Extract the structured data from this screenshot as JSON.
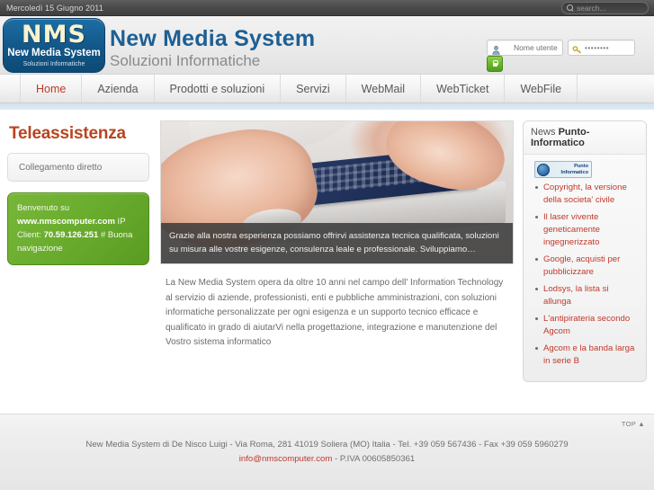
{
  "topbar": {
    "date": "Mercoledì 15 Giugno 2011",
    "search_placeholder": "search...",
    "search_value": "",
    "search_icon": "magnifier-icon"
  },
  "header": {
    "logo": {
      "mark": "NMS",
      "line2": "New Media System",
      "line3": "Soluzioni Informatiche"
    },
    "brand_title": "New Media System",
    "brand_subtitle": "Soluzioni Informatiche",
    "login": {
      "username_value": "Nome utente",
      "username_icon": "user-icon",
      "password_value": "••••••••",
      "password_icon": "key-icon",
      "submit_icon": "lock-icon"
    }
  },
  "nav": {
    "items": [
      {
        "label": "Home",
        "active": true
      },
      {
        "label": "Azienda",
        "active": false
      },
      {
        "label": "Prodotti e soluzioni",
        "active": false
      },
      {
        "label": "Servizi",
        "active": false
      },
      {
        "label": "WebMail",
        "active": false
      },
      {
        "label": "WebTicket",
        "active": false
      },
      {
        "label": "WebFile",
        "active": false
      }
    ]
  },
  "left": {
    "heading": "Teleassistenza",
    "direct_link_label": "Collegamento diretto",
    "welcome": {
      "line1": "Benvenuto su",
      "site": "www.nmscomputer.com",
      "ip_label": " IP Client: ",
      "ip": "70.59.126.251",
      "tail": " # Buona navigazione"
    }
  },
  "main": {
    "hero_caption": "Grazie alla nostra esperienza possiamo offrirvi assistenza tecnica qualificata, soluzioni su misura alle vostre esigenze, consulenza leale e professionale. Sviluppiamo…",
    "intro": "La New Media System opera da oltre 10 anni nel campo dell' Information Technology al servizio di aziende, professionisti, enti e pubbliche amministrazioni, con soluzioni informatiche personalizzate per ogni esigenza e un supporto tecnico efficace e qualificato in grado di aiutarVi nella progettazione, integrazione e manutenzione del Vostro sistema informatico"
  },
  "news": {
    "head_prefix": "News ",
    "head_strong": "Punto-Informatico",
    "logo_line1": "Punto",
    "logo_line2": "Informatico",
    "items": [
      "Copyright, la versione della societa' civile",
      "Il laser vivente geneticamente ingegnerizzato",
      "Google, acquisti per pubblicizzare",
      "Lodsys, la lista si allunga",
      "L'antipirateria secondo Agcom",
      "Agcom e la banda larga in serie B"
    ]
  },
  "footer": {
    "top_label": "TOP ▲",
    "line1": "New Media System di De Nisco Luigi - Via Roma, 281 41019 Soliera (MO) Italia - Tel. +39 059 567436 - Fax +39 059 5960279",
    "email": "info@nmscomputer.com",
    "line2_tail": " - P.IVA 00605850361"
  },
  "colors": {
    "brand_blue": "#1d5f94",
    "accent_red": "#c0392b",
    "heading_orange": "#b8441f",
    "green": "#6aad2e"
  }
}
